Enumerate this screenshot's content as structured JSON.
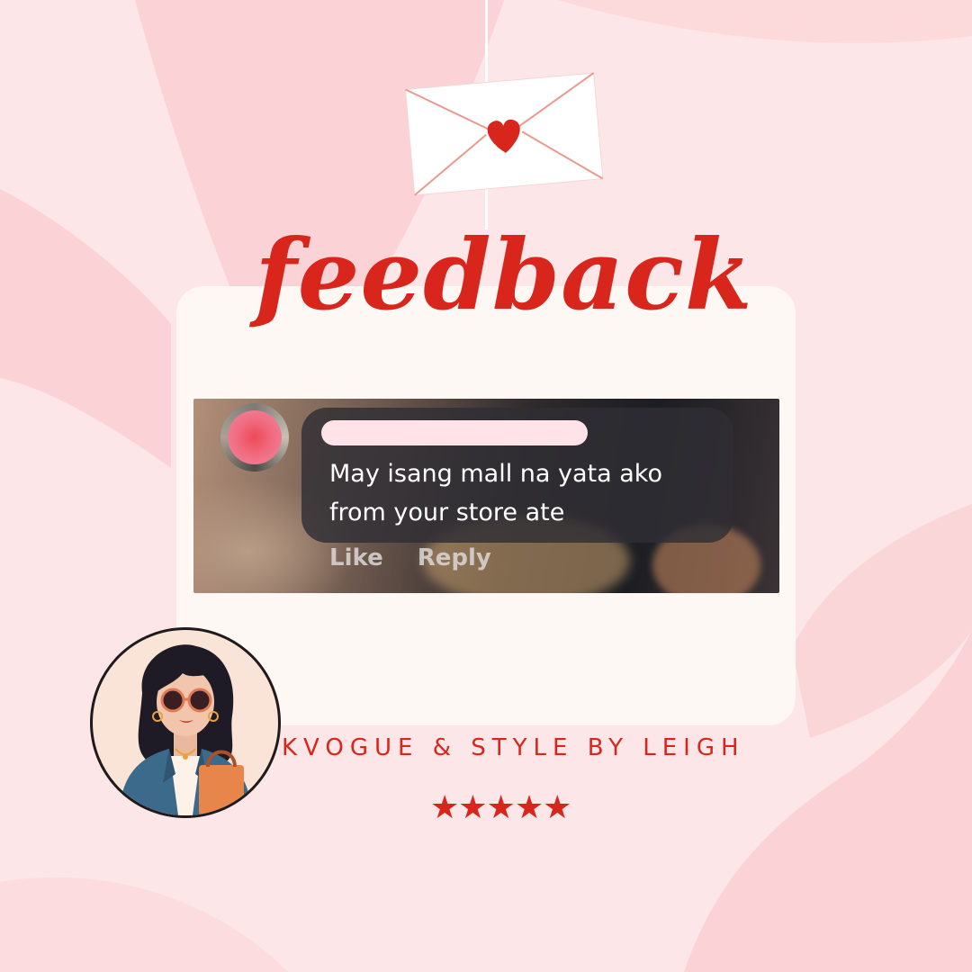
{
  "colors": {
    "background": "#fde6e7",
    "shape": "#fbd2d6",
    "card": "#fdf8f3",
    "accent": "#d9261c",
    "envelope": "#ffffff",
    "envelope_lines": "#e89a8e"
  },
  "header": {
    "envelope_icon": "envelope-heart-icon",
    "title": "feedback"
  },
  "comment": {
    "avatar": "blurred-avatar",
    "author_redacted": true,
    "text": "May isang mall na yata ako from your store ate",
    "like_label": "Like",
    "reply_label": "Reply"
  },
  "footer": {
    "logo": "woman-with-sunglasses-and-shopping-bag-illustration",
    "brand": "KVOGUE & STYLE BY LEIGH",
    "stars": "★★★★★",
    "rating": 5
  }
}
